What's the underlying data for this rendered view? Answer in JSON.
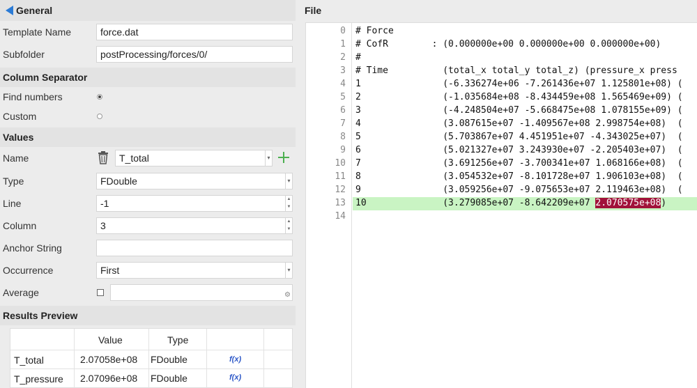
{
  "general": {
    "header": "General",
    "template_name_label": "Template Name",
    "template_name_value": "force.dat",
    "subfolder_label": "Subfolder",
    "subfolder_value": "postProcessing/forces/0/"
  },
  "column_separator": {
    "header": "Column Separator",
    "find_numbers_label": "Find numbers",
    "custom_label": "Custom",
    "selected": "Find numbers"
  },
  "values": {
    "header": "Values",
    "name_label": "Name",
    "name_value": "T_total",
    "type_label": "Type",
    "type_value": "FDouble",
    "line_label": "Line",
    "line_value": "-1",
    "column_label": "Column",
    "column_value": "3",
    "anchor_label": "Anchor String",
    "anchor_value": "",
    "occurrence_label": "Occurrence",
    "occurrence_value": "First",
    "average_label": "Average",
    "average_checked": false
  },
  "results_preview": {
    "header": "Results Preview",
    "columns": [
      "Value",
      "Type"
    ],
    "rows": [
      {
        "name": "T_total",
        "value": "2.07058e+08",
        "type": "FDouble",
        "fx": "f(x)"
      },
      {
        "name": "T_pressure",
        "value": "2.07096e+08",
        "type": "FDouble",
        "fx": "f(x)"
      }
    ]
  },
  "file": {
    "header": "File",
    "line_numbers": [
      "0",
      "1",
      "2",
      "3",
      "4",
      "5",
      "6",
      "7",
      "8",
      "9",
      "10",
      "11",
      "12",
      "13",
      "14"
    ],
    "lines": [
      "# Force",
      "# CofR        : (0.000000e+00 0.000000e+00 0.000000e+00)",
      "#",
      "# Time          (total_x total_y total_z) (pressure_x press",
      "1               (-6.336274e+06 -7.261436e+07 1.125801e+08) (",
      "2               (-1.035684e+08 -8.434459e+08 1.565469e+09) (",
      "3               (-4.248504e+07 -5.668475e+08 1.078155e+09) (",
      "4               (3.087615e+07 -1.409567e+08 2.998754e+08)  (",
      "5               (5.703867e+07 4.451951e+07 -4.343025e+07)  (",
      "6               (5.021327e+07 3.243930e+07 -2.205403e+07)  (",
      "7               (3.691256e+07 -3.700341e+07 1.068166e+08)  (",
      "8               (3.054532e+07 -8.101728e+07 1.906103e+08)  (",
      "9               (3.059256e+07 -9.075653e+07 2.119463e+08)  (",
      "",
      ""
    ],
    "line13_prefix": "10              (3.279085e+07 -8.642209e+07 ",
    "line13_selected": "2.070575e+08",
    "line13_suffix": ")",
    "highlight_line": 13,
    "highlight_color": "#c9f4c3",
    "selection_color": "#a1123a"
  },
  "colors": {
    "accent": "#2b7bd6",
    "add_icon": "#4caf50",
    "fx": "#2d58c8"
  }
}
